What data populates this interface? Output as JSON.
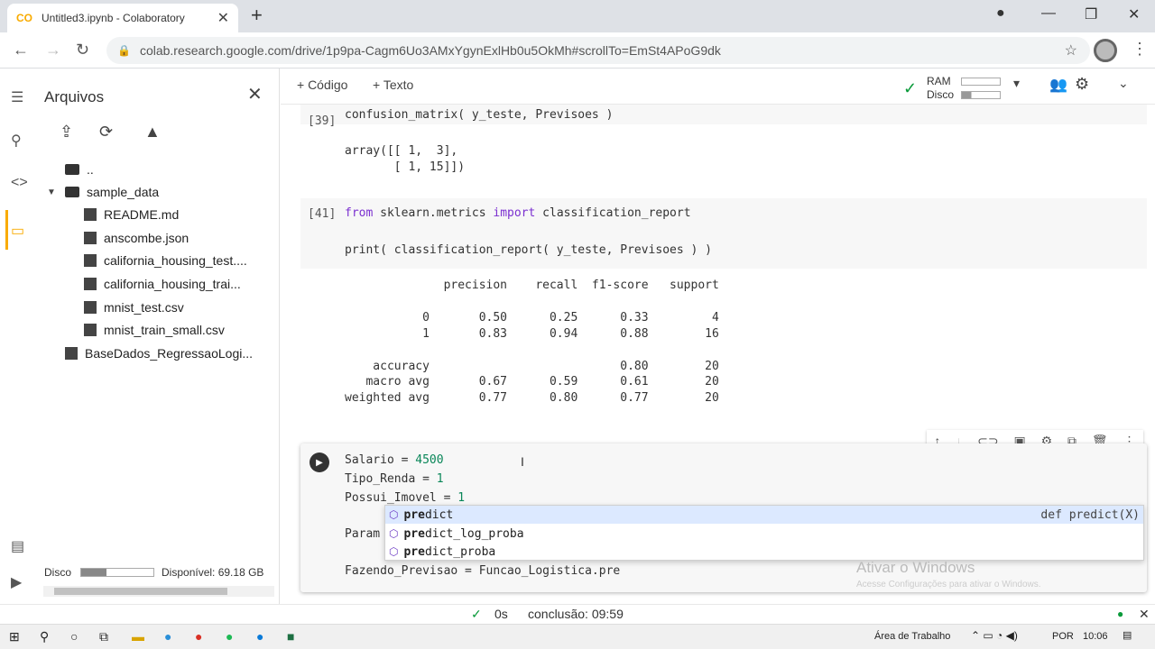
{
  "browser": {
    "tab_title": "Untitled3.ipynb - Colaboratory",
    "tab_favicon": "CO",
    "url": "colab.research.google.com/drive/1p9pa-Cagm6Uo3AMxYgynExlHb0u5OkMh#scrollTo=EmSt4APoG9dk"
  },
  "files_panel": {
    "title": "Arquivos",
    "tree": [
      {
        "label": "..",
        "type": "folder-up"
      },
      {
        "label": "sample_data",
        "type": "folder"
      },
      {
        "label": "README.md",
        "type": "file"
      },
      {
        "label": "anscombe.json",
        "type": "file"
      },
      {
        "label": "california_housing_test....",
        "type": "file"
      },
      {
        "label": "california_housing_trai...",
        "type": "file"
      },
      {
        "label": "mnist_test.csv",
        "type": "file"
      },
      {
        "label": "mnist_train_small.csv",
        "type": "file"
      },
      {
        "label": "BaseDados_RegressaoLogi...",
        "type": "file"
      }
    ],
    "disk_label": "Disco",
    "disk_available": "Disponível: 69.18 GB",
    "disk_used_fraction": 0.35
  },
  "toolbar": {
    "add_code": "+ Código",
    "add_text": "+ Texto",
    "ram_label": "RAM",
    "disk_label": "Disco"
  },
  "cells": {
    "c39_prompt": "[39]",
    "c39_code": "confusion_matrix( y_teste, Previsoes )",
    "c39_out": "array([[ 1,  3],\n       [ 1, 15]])",
    "c41_prompt": "[41]",
    "c41_line1_kw1": "from",
    "c41_line1_mod": " sklearn.metrics ",
    "c41_line1_kw2": "import",
    "c41_line1_name": " classification_report",
    "c41_line2": "print( classification_report( y_teste, Previsoes ) )",
    "report": "              precision    recall  f1-score   support\n\n           0       0.50      0.25      0.33         4\n           1       0.83      0.94      0.88        16\n\n    accuracy                           0.80        20\n   macro avg       0.67      0.59      0.61        20\nweighted avg       0.77      0.80      0.77        20",
    "c3_line1_name": "Salario = ",
    "c3_line1_val": "4500",
    "c3_line2_name": "Tipo_Renda = ",
    "c3_line2_val": "1",
    "c3_line3_name": "Possui_Imovel = ",
    "c3_line3_val": "1",
    "c3_line4": "Param",
    "c3_line5": "Fazendo_Previsao = Funcao_Logistica.pre"
  },
  "autocomplete": {
    "items": [
      {
        "prefix": "pre",
        "rest": "dict",
        "selected": true
      },
      {
        "prefix": "pre",
        "rest": "dict_log_proba",
        "selected": false
      },
      {
        "prefix": "pre",
        "rest": "dict_proba",
        "selected": false
      }
    ],
    "signature": "def predict(X)"
  },
  "watermark": {
    "line1": "Ativar o Windows",
    "line2": "Acesse Configurações para ativar o Windows."
  },
  "status": {
    "time": "0s",
    "conclusion": "conclusão: 09:59"
  },
  "taskbar": {
    "desktop": "Área de Trabalho",
    "lang": "POR",
    "clock": "10:06"
  }
}
